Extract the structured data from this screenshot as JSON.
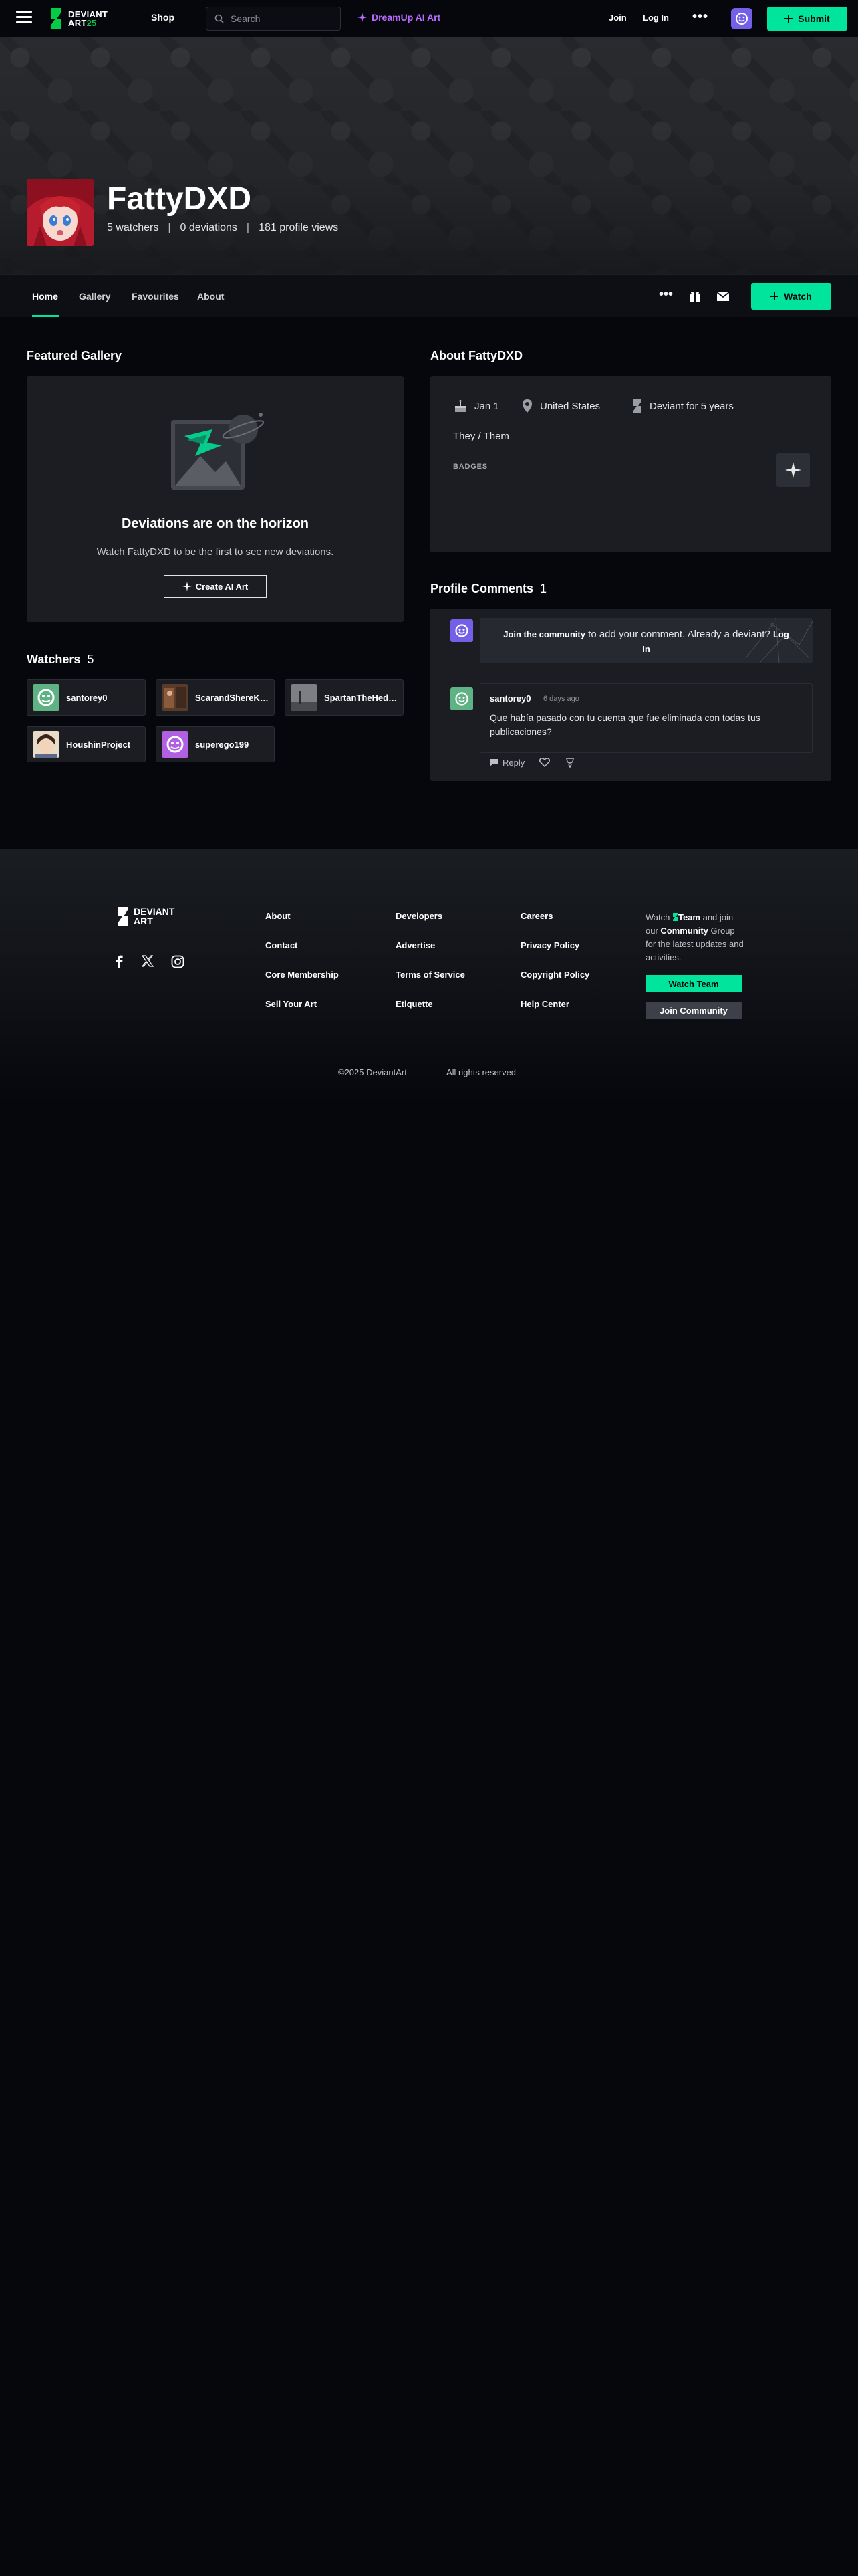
{
  "topbar": {
    "logo_line1": "DEVIANT",
    "logo_line2": "ART",
    "logo_badge": "25",
    "shop": "Shop",
    "search_placeholder": "Search",
    "dreamup": "DreamUp AI Art",
    "join": "Join",
    "login": "Log In",
    "more": "•••",
    "submit": "Submit",
    "accent_color": "#00e59b",
    "dreamup_color": "#b96bff"
  },
  "profile": {
    "name": "FattyDXD",
    "watchers": "5 watchers",
    "deviations": "0 deviations",
    "views": "181 profile views",
    "separator": "|"
  },
  "tabs": {
    "items": [
      {
        "label": "Home"
      },
      {
        "label": "Gallery"
      },
      {
        "label": "Favourites"
      },
      {
        "label": "About"
      }
    ],
    "watch": "Watch"
  },
  "featured": {
    "title": "Featured Gallery",
    "empty_title": "Deviations are on the horizon",
    "empty_text": "Watch FattyDXD to be the first to see new deviations.",
    "cta": "Create AI Art"
  },
  "watchers": {
    "title": "Watchers",
    "count": "5",
    "items": [
      {
        "name": "santorey0"
      },
      {
        "name": "ScarandShereKhan"
      },
      {
        "name": "SpartanTheHedgehog"
      },
      {
        "name": "HoushinProject"
      },
      {
        "name": "superego199"
      }
    ]
  },
  "about": {
    "title": "About FattyDXD",
    "birthday": "Jan 1",
    "location": "United States",
    "member_for": "Deviant for 5 years",
    "pronouns": "They / Them",
    "badges_label": "BADGES"
  },
  "comments": {
    "title": "Profile Comments",
    "count": "1",
    "join_link": "Join the community",
    "join_text": " to add your comment. Already a deviant? ",
    "login_link": "Log In",
    "items": [
      {
        "user": "santorey0",
        "time": "6 days ago",
        "body": "Que había pasado con tu cuenta que fue eliminada con todas tus publicaciones?",
        "reply": "Reply"
      }
    ]
  },
  "footer": {
    "logo_line1": "DEVIANT",
    "logo_line2": "ART",
    "col1": [
      "About",
      "Contact",
      "Core Membership",
      "Sell Your Art"
    ],
    "col2": [
      "Developers",
      "Advertise",
      "Terms of Service",
      "Etiquette"
    ],
    "col3": [
      "Careers",
      "Privacy Policy",
      "Copyright Policy",
      "Help Center"
    ],
    "watch_prefix": "Watch ",
    "watch_team": "Team",
    "watch_mid": " and join our ",
    "watch_community": "Community",
    "watch_suffix": " Group for the latest updates and activities.",
    "watch_team_btn": "Watch Team",
    "join_community_btn": "Join Community",
    "copyright": "©2025 DeviantArt",
    "rights": "All rights reserved"
  }
}
